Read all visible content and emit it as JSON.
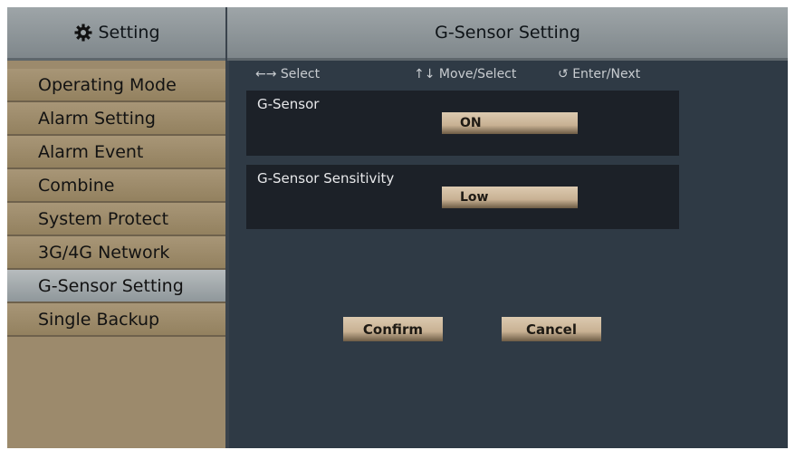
{
  "sidebar": {
    "title": "Setting",
    "icon": "gear-icon",
    "items": [
      {
        "label": "Operating Mode",
        "active": false
      },
      {
        "label": "Alarm Setting",
        "active": false
      },
      {
        "label": "Alarm Event",
        "active": false
      },
      {
        "label": "Combine",
        "active": false
      },
      {
        "label": "System Protect",
        "active": false
      },
      {
        "label": "3G/4G Network",
        "active": false
      },
      {
        "label": "G-Sensor Setting",
        "active": true
      },
      {
        "label": "Single Backup",
        "active": false
      }
    ]
  },
  "main": {
    "title": "G-Sensor Setting",
    "hints": [
      {
        "icon": "left-right-arrows-icon",
        "glyph": "←→",
        "label": "Select"
      },
      {
        "icon": "up-down-arrows-icon",
        "glyph": "↑↓",
        "label": "Move/Select"
      },
      {
        "icon": "enter-icon",
        "glyph": "↺",
        "label": "Enter/Next"
      }
    ],
    "settings": [
      {
        "label": "G-Sensor",
        "value": "ON"
      },
      {
        "label": "G-Sensor Sensitivity",
        "value": "Low"
      }
    ],
    "confirm_label": "Confirm",
    "cancel_label": "Cancel"
  },
  "colors": {
    "sidebar_bg": "#9c8a6c",
    "header_bg": "#8f979b",
    "content_bg": "#2f3a45",
    "panel_bg": "#1c2128",
    "button_bg": "#c8b193"
  }
}
